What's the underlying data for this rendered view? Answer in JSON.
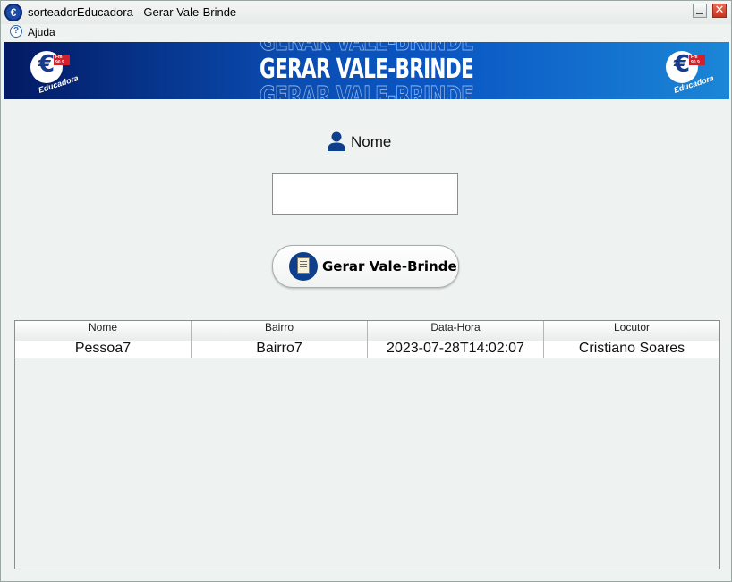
{
  "window": {
    "title": "sorteadorEducadora - Gerar Vale-Brinde",
    "close_glyph": "✕",
    "app_icon_glyph": "€"
  },
  "menu": {
    "items": [
      {
        "label": "Ajuda",
        "icon": "help-icon",
        "icon_glyph": "?"
      }
    ]
  },
  "banner": {
    "title": "GERAR VALE-BRINDE",
    "logo_left": "educadora-logo",
    "logo_right": "educadora-logo",
    "logo_text": "Educadora",
    "logo_fm": "Fm 90.9",
    "colors": {
      "start": "#031a63",
      "end": "#1b86d6"
    }
  },
  "form": {
    "name_label": "Nome",
    "name_icon": "user-icon",
    "name_value": "",
    "button_label": "Gerar Vale-Brinde",
    "button_icon": "notepad-icon"
  },
  "table": {
    "columns": [
      "Nome",
      "Bairro",
      "Data-Hora",
      "Locutor"
    ],
    "rows": [
      [
        "Pessoa7",
        "Bairro7",
        "2023-07-28T14:02:07",
        "Cristiano Soares"
      ]
    ]
  },
  "colors": {
    "accent": "#0d3f8c",
    "background": "#eef2f1"
  }
}
